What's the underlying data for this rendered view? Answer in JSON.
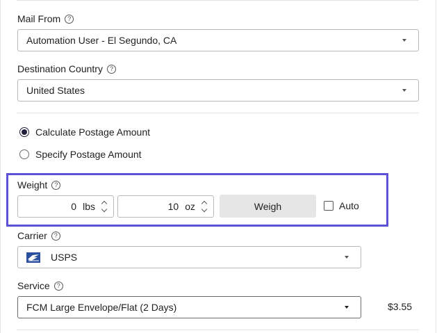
{
  "mail_from": {
    "label": "Mail From",
    "help_icon": "?",
    "value": "Automation User - El Segundo, CA"
  },
  "destination_country": {
    "label": "Destination Country",
    "help_icon": "?",
    "value": "United States"
  },
  "postage_options": {
    "calculate_label": "Calculate Postage Amount",
    "specify_label": "Specify Postage Amount",
    "selected": "calculate"
  },
  "weight": {
    "label": "Weight",
    "help_icon": "?",
    "lbs_value": "0",
    "lbs_unit": "lbs",
    "oz_value": "10",
    "oz_unit": "oz",
    "weigh_button": "Weigh",
    "auto_label": "Auto",
    "auto_checked": false
  },
  "carrier": {
    "label": "Carrier",
    "help_icon": "?",
    "value": "USPS",
    "logo_icon": "usps-eagle-icon"
  },
  "service": {
    "label": "Service",
    "help_icon": "?",
    "value": "FCM Large Envelope/Flat (2 Days)",
    "price": "$3.55"
  },
  "colors": {
    "highlight": "#5b52d9",
    "usps_blue": "#2c4f9e"
  }
}
